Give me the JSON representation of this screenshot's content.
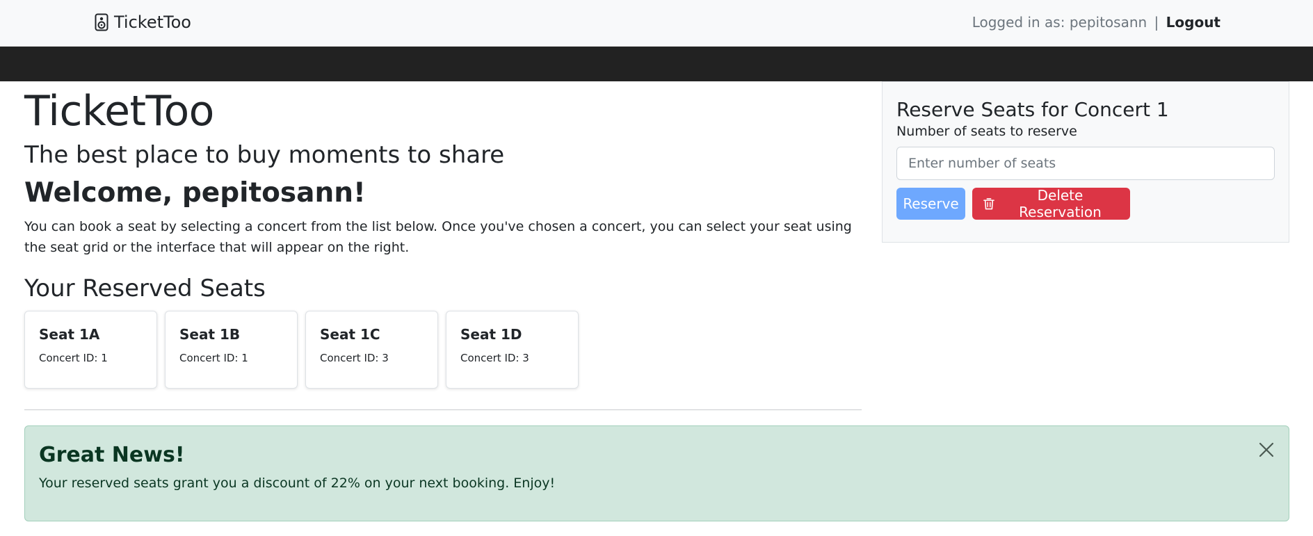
{
  "navbar": {
    "brand": "TicketToo",
    "logged_in_text": "Logged in as: pepitosann",
    "separator": "|",
    "logout_label": "Logout"
  },
  "hero": {
    "title": "TicketToo",
    "tagline": "The best place to buy moments to share",
    "welcome": "Welcome, pepitosann!",
    "intro": "You can book a seat by selecting a concert from the list below. Once you've chosen a concert, you can select your seat using the seat grid or the interface that will appear on the right."
  },
  "reserved": {
    "title": "Your Reserved Seats",
    "seats": [
      {
        "seat": "Seat 1A",
        "concert": "Concert ID: 1"
      },
      {
        "seat": "Seat 1B",
        "concert": "Concert ID: 1"
      },
      {
        "seat": "Seat 1C",
        "concert": "Concert ID: 3"
      },
      {
        "seat": "Seat 1D",
        "concert": "Concert ID: 3"
      }
    ]
  },
  "panel": {
    "title": "Reserve Seats for Concert 1",
    "label": "Number of seats to reserve",
    "placeholder": "Enter number of seats",
    "reserve_label": "Reserve",
    "delete_label": "Delete Reservation"
  },
  "alert": {
    "heading": "Great News!",
    "text": "Your reserved seats grant you a discount of 22% on your next booking. Enjoy!"
  },
  "icons": {
    "brand": "speaker-icon",
    "delete": "trash-icon",
    "close": "close-icon"
  },
  "colors": {
    "reserve_button": "#6ea8fe",
    "delete_button": "#dc3545",
    "alert_background": "#d1e7dd",
    "dark_bar": "#222222"
  }
}
